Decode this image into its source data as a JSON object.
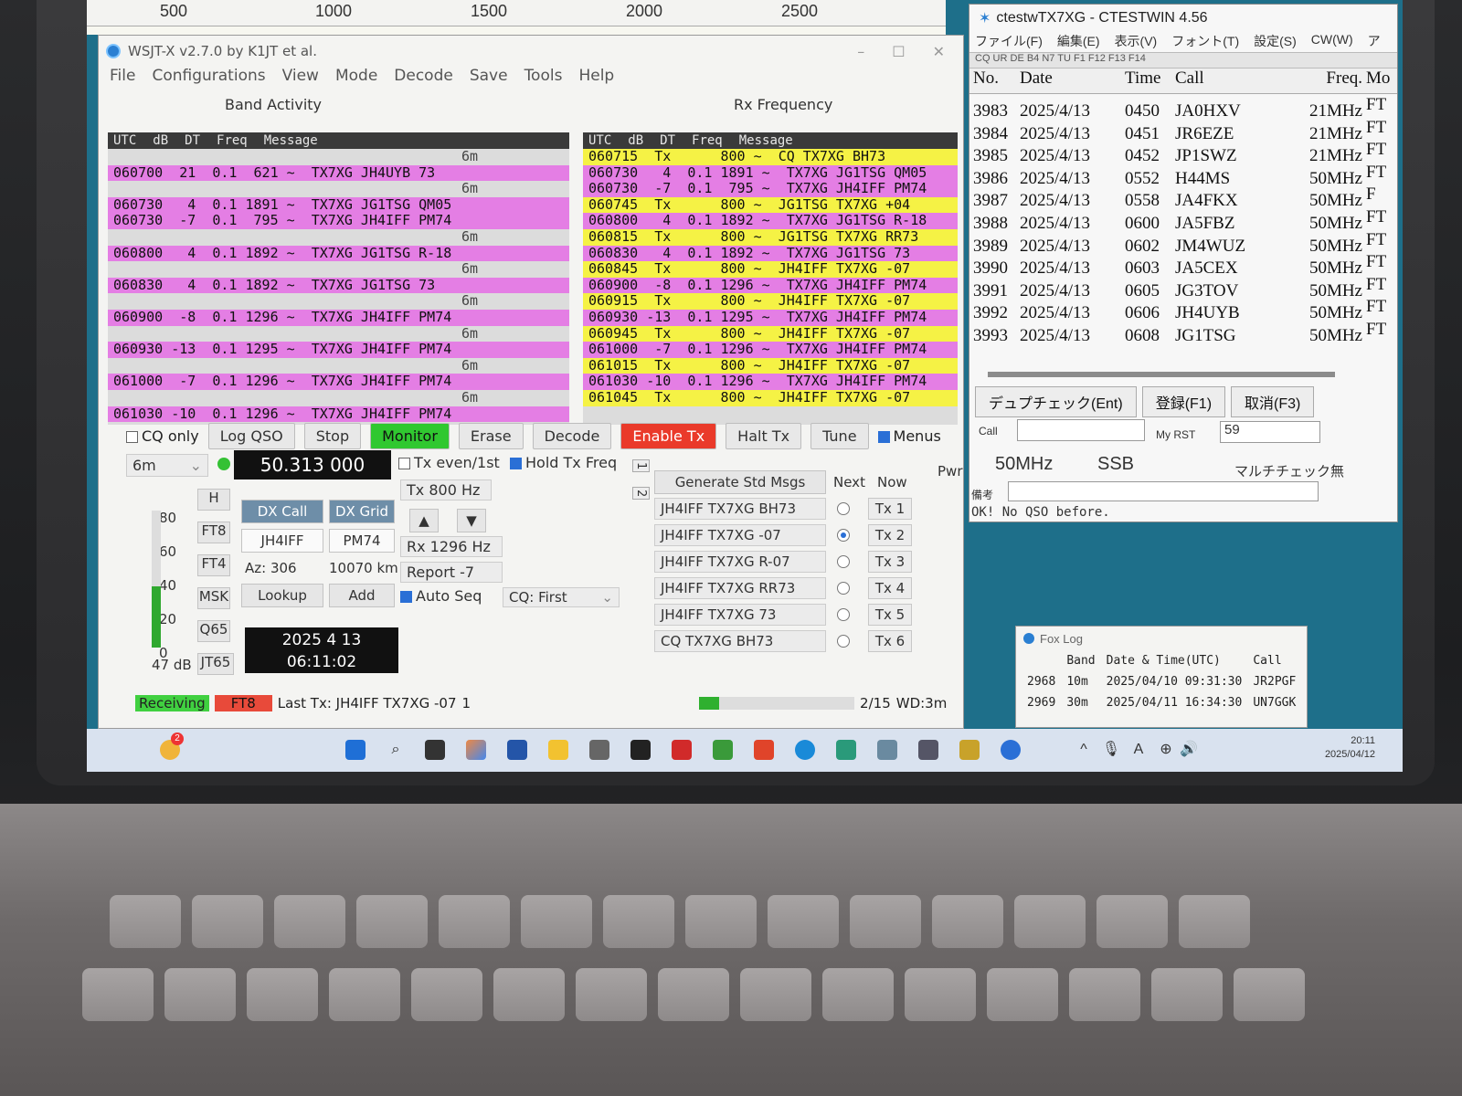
{
  "waterfall": {
    "ticks": [
      "500",
      "1000",
      "1500",
      "2000",
      "2500"
    ]
  },
  "wsjt": {
    "title": "WSJT-X   v2.7.0   by K1JT et al.",
    "menu": [
      "File",
      "Configurations",
      "View",
      "Mode",
      "Decode",
      "Save",
      "Tools",
      "Help"
    ],
    "band_activity_title": "Band Activity",
    "rx_frequency_title": "Rx Frequency",
    "band_headers": [
      "UTC",
      "dB",
      "DT",
      "Freq",
      "Message"
    ],
    "rx_headers": [
      "UTC",
      "dB",
      "DT",
      "Freq",
      "Message"
    ],
    "band_rows": [
      {
        "kind": "sep",
        "text": "6m"
      },
      {
        "kind": "rx",
        "text": "060700  21  0.1  621 ~  TX7XG JH4UYB 73"
      },
      {
        "kind": "sep",
        "text": "6m"
      },
      {
        "kind": "rx",
        "text": "060730   4  0.1 1891 ~  TX7XG JG1TSG QM05"
      },
      {
        "kind": "rx",
        "text": "060730  -7  0.1  795 ~  TX7XG JH4IFF PM74"
      },
      {
        "kind": "sep",
        "text": "6m"
      },
      {
        "kind": "rx",
        "text": "060800   4  0.1 1892 ~  TX7XG JG1TSG R-18"
      },
      {
        "kind": "sep",
        "text": "6m"
      },
      {
        "kind": "rx",
        "text": "060830   4  0.1 1892 ~  TX7XG JG1TSG 73"
      },
      {
        "kind": "sep",
        "text": "6m"
      },
      {
        "kind": "rx",
        "text": "060900  -8  0.1 1296 ~  TX7XG JH4IFF PM74"
      },
      {
        "kind": "sep",
        "text": "6m"
      },
      {
        "kind": "rx",
        "text": "060930 -13  0.1 1295 ~  TX7XG JH4IFF PM74"
      },
      {
        "kind": "sep",
        "text": "6m"
      },
      {
        "kind": "rx",
        "text": "061000  -7  0.1 1296 ~  TX7XG JH4IFF PM74"
      },
      {
        "kind": "sep",
        "text": "6m"
      },
      {
        "kind": "rx",
        "text": "061030 -10  0.1 1296 ~  TX7XG JH4IFF PM74"
      }
    ],
    "rx_rows": [
      {
        "kind": "tx",
        "text": "060715  Tx      800 ~  CQ TX7XG BH73"
      },
      {
        "kind": "rx",
        "text": "060730   4  0.1 1891 ~  TX7XG JG1TSG QM05"
      },
      {
        "kind": "rx",
        "text": "060730  -7  0.1  795 ~  TX7XG JH4IFF PM74"
      },
      {
        "kind": "tx",
        "text": "060745  Tx      800 ~  JG1TSG TX7XG +04"
      },
      {
        "kind": "rx",
        "text": "060800   4  0.1 1892 ~  TX7XG JG1TSG R-18"
      },
      {
        "kind": "tx",
        "text": "060815  Tx      800 ~  JG1TSG TX7XG RR73"
      },
      {
        "kind": "rx",
        "text": "060830   4  0.1 1892 ~  TX7XG JG1TSG 73"
      },
      {
        "kind": "tx",
        "text": "060845  Tx      800 ~  JH4IFF TX7XG -07"
      },
      {
        "kind": "rx",
        "text": "060900  -8  0.1 1296 ~  TX7XG JH4IFF PM74"
      },
      {
        "kind": "tx",
        "text": "060915  Tx      800 ~  JH4IFF TX7XG -07"
      },
      {
        "kind": "rx",
        "text": "060930 -13  0.1 1295 ~  TX7XG JH4IFF PM74"
      },
      {
        "kind": "tx",
        "text": "060945  Tx      800 ~  JH4IFF TX7XG -07"
      },
      {
        "kind": "rx",
        "text": "061000  -7  0.1 1296 ~  TX7XG JH4IFF PM74"
      },
      {
        "kind": "tx",
        "text": "061015  Tx      800 ~  JH4IFF TX7XG -07"
      },
      {
        "kind": "rx",
        "text": "061030 -10  0.1 1296 ~  TX7XG JH4IFF PM74"
      },
      {
        "kind": "tx",
        "text": "061045  Tx      800 ~  JH4IFF TX7XG -07"
      }
    ],
    "buttons": {
      "cq_only": "CQ only",
      "log_qso": "Log QSO",
      "stop": "Stop",
      "monitor": "Monitor",
      "erase": "Erase",
      "decode": "Decode",
      "enable_tx": "Enable Tx",
      "halt_tx": "Halt Tx",
      "tune": "Tune",
      "menus": "Menus"
    },
    "band": "6m",
    "dial_freq": "50.313 000",
    "tx_even": "Tx even/1st",
    "hold_tx_freq": "Hold Tx Freq",
    "tx_freq": "Tx  800  Hz",
    "rx_freq": "Rx  1296  Hz",
    "report": "Report -7",
    "auto_seq": "Auto Seq",
    "cq_mode": "CQ: First",
    "dx_call_label": "DX Call",
    "dx_grid_label": "DX Grid",
    "dx_call": "JH4IFF",
    "dx_grid": "PM74",
    "azimuth": "Az: 306",
    "distance": "10070 km",
    "lookup": "Lookup",
    "add": "Add",
    "mode_buttons": [
      "H",
      "FT8",
      "FT4",
      "MSK",
      "Q65",
      "JT65"
    ],
    "meter_ticks": [
      "80",
      "60",
      "40",
      "20",
      "0"
    ],
    "meter_db": "47 dB",
    "meter_level_db": 40,
    "date": "2025 4 13",
    "time": "06:11:02",
    "pwr": "Pwr",
    "tab1": "1",
    "tab2": "2",
    "gen_std": "Generate Std Msgs",
    "next": "Next",
    "now": "Now",
    "messages": [
      {
        "text": "JH4IFF TX7XG BH73",
        "tx": "Tx 1",
        "selected": false
      },
      {
        "text": "JH4IFF TX7XG -07",
        "tx": "Tx 2",
        "selected": true
      },
      {
        "text": "JH4IFF TX7XG R-07",
        "tx": "Tx 3",
        "selected": false
      },
      {
        "text": "JH4IFF TX7XG RR73",
        "tx": "Tx 4",
        "selected": false
      },
      {
        "text": "JH4IFF TX7XG 73",
        "tx": "Tx 5",
        "selected": false
      },
      {
        "text": "CQ TX7XG BH73",
        "tx": "Tx 6",
        "selected": false
      }
    ],
    "status": {
      "receiving": "Receiving",
      "mode": "FT8",
      "last_tx": "Last Tx: JH4IFF TX7XG -07",
      "count": "1",
      "progress": "2/15",
      "wd": "WD:3m",
      "progress_fraction": 0.13
    }
  },
  "ctest": {
    "title": "ctestwTX7XG  - CTESTWIN  4.56",
    "menu": [
      "ファイル(F)",
      "編集(E)",
      "表示(V)",
      "フォント(T)",
      "設定(S)",
      "CW(W)",
      "ア"
    ],
    "toolbar_text": "CQ UR DE B4 N7 TU F1 F12 F13 F14",
    "headers": {
      "no": "No.",
      "date": "Date",
      "time": "Time",
      "call": "Call",
      "freq": "Freq.",
      "mode": "Mo"
    },
    "rows": [
      {
        "no": "3983",
        "date": "2025/4/13",
        "time": "0450",
        "call": "JA0HXV",
        "freq": "21MHz",
        "mode": "FT"
      },
      {
        "no": "3984",
        "date": "2025/4/13",
        "time": "0451",
        "call": "JR6EZE",
        "freq": "21MHz",
        "mode": "FT"
      },
      {
        "no": "3985",
        "date": "2025/4/13",
        "time": "0452",
        "call": "JP1SWZ",
        "freq": "21MHz",
        "mode": "FT"
      },
      {
        "no": "3986",
        "date": "2025/4/13",
        "time": "0552",
        "call": "H44MS",
        "freq": "50MHz",
        "mode": "FT"
      },
      {
        "no": "3987",
        "date": "2025/4/13",
        "time": "0558",
        "call": "JA4FKX",
        "freq": "50MHz",
        "mode": "F"
      },
      {
        "no": "3988",
        "date": "2025/4/13",
        "time": "0600",
        "call": "JA5FBZ",
        "freq": "50MHz",
        "mode": "FT"
      },
      {
        "no": "3989",
        "date": "2025/4/13",
        "time": "0602",
        "call": "JM4WUZ",
        "freq": "50MHz",
        "mode": "FT"
      },
      {
        "no": "3990",
        "date": "2025/4/13",
        "time": "0603",
        "call": "JA5CEX",
        "freq": "50MHz",
        "mode": "FT"
      },
      {
        "no": "3991",
        "date": "2025/4/13",
        "time": "0605",
        "call": "JG3TOV",
        "freq": "50MHz",
        "mode": "FT"
      },
      {
        "no": "3992",
        "date": "2025/4/13",
        "time": "0606",
        "call": "JH4UYB",
        "freq": "50MHz",
        "mode": "FT"
      },
      {
        "no": "3993",
        "date": "2025/4/13",
        "time": "0608",
        "call": "JG1TSG",
        "freq": "50MHz",
        "mode": "FT"
      }
    ],
    "dupe_check": "デュプチェック(Ent)",
    "register": "登録(F1)",
    "cancel": "取消(F3)",
    "call_label": "Call",
    "my_rst_label": "My RST",
    "my_rst": "59",
    "band": "50MHz",
    "mode": "SSB",
    "multi_check": "マルチチェック無",
    "remarks_label": "備考",
    "status_msg": "OK! No QSO before."
  },
  "foxlog": {
    "title": "Fox Log",
    "headers": [
      "",
      "Band",
      "Date & Time(UTC)",
      "Call"
    ],
    "rows": [
      {
        "no": "2968",
        "band": "10m",
        "datetime": "2025/04/10 09:31:30",
        "call": "JR2PGF"
      },
      {
        "no": "2969",
        "band": "30m",
        "datetime": "2025/04/11 16:34:30",
        "call": "UN7GGK"
      }
    ]
  },
  "taskbar": {
    "time": "20:11",
    "date": "2025/04/12",
    "weather_badge": "2"
  }
}
